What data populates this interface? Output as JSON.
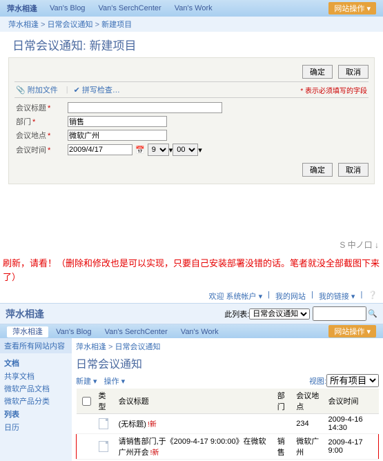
{
  "top": {
    "site": "萍水相逢",
    "tabs": [
      "Van's Blog",
      "Van's SerchCenter",
      "Van's Work"
    ],
    "siteOps": "网站操作 ▾"
  },
  "breadcrumb": [
    "萍水相逢",
    "日常会议通知",
    "新建项目"
  ],
  "title": "日常会议通知: 新建项目",
  "buttons": {
    "ok": "确定",
    "cancel": "取消"
  },
  "toolbar": {
    "attach": "附加文件",
    "spell": "拼写检查…",
    "required": "* 表示必须填写的字段"
  },
  "form": {
    "f1": {
      "label": "会议标题",
      "value": ""
    },
    "f2": {
      "label": "部门",
      "value": "销售"
    },
    "f3": {
      "label": "会议地点",
      "value": "微软广州"
    },
    "f4": {
      "label": "会议时间",
      "value": "2009/4/17",
      "hour": "9",
      "min": "00"
    }
  },
  "annotation": "刷新，请看！（删除和修改也是可以实现，只要自己安装部署没错的话。笔者就没全部截图下来了）",
  "login": {
    "welcome": "欢迎 系统帐户 ▾",
    "mysite": "我的网站",
    "mylinks": "我的链接 ▾"
  },
  "viewbar": {
    "label": "此列表:",
    "view": "日常会议通知"
  },
  "title2": "日常会议通知",
  "side": {
    "all": "查看所有网站内容",
    "g1": "文档",
    "g1items": [
      "共享文档",
      "微软产品文档",
      "微软产品分类"
    ],
    "g2": "列表",
    "g2items": [
      "日历"
    ]
  },
  "listtool": {
    "new": "新建 ▾",
    "ops": "操作 ▾",
    "viewlbl": "视图:",
    "view": "所有项目"
  },
  "cols": {
    "type": "类型",
    "title": "会议标题",
    "dept": "部门",
    "loc": "会议地点",
    "time": "会议时间"
  },
  "rows": [
    {
      "title": "(无标题)",
      "new": "!新",
      "dept": "",
      "loc": "234",
      "time": "2009-4-16 14:30"
    },
    {
      "title": "请销售部门,于《2009-4-17 9:00:00》在微软广州开会",
      "new": "!新",
      "dept": "销售",
      "loc": "微软广州",
      "time": "2009-4-17 9:00"
    }
  ],
  "sysicons": "S 中ノ口 ↓"
}
